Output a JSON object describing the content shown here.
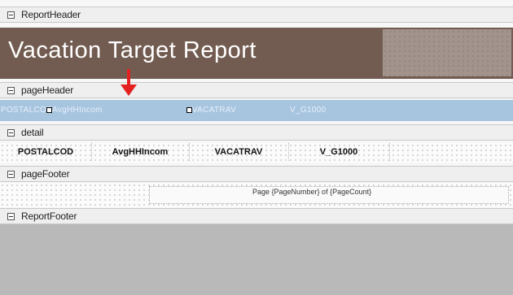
{
  "sections": {
    "report_header": "ReportHeader",
    "page_header": "pageHeader",
    "detail": "detail",
    "page_footer": "pageFooter",
    "report_footer": "ReportFooter"
  },
  "report_title": "Vacation Target Report",
  "page_header_fields": [
    "POSTALCOD",
    "AvgHHIncom",
    "VACATRAV",
    "V_G1000"
  ],
  "detail_fields": [
    "POSTALCOD",
    "AvgHHIncom",
    "VACATRAV",
    "V_G1000"
  ],
  "page_footer_text": "Page {PageNumber} of {PageCount}",
  "colors": {
    "header_bg": "#725c51",
    "page_header_bg": "#a8c5df",
    "arrow": "#e3221f",
    "report_footer_bg": "#b9b9b9"
  }
}
